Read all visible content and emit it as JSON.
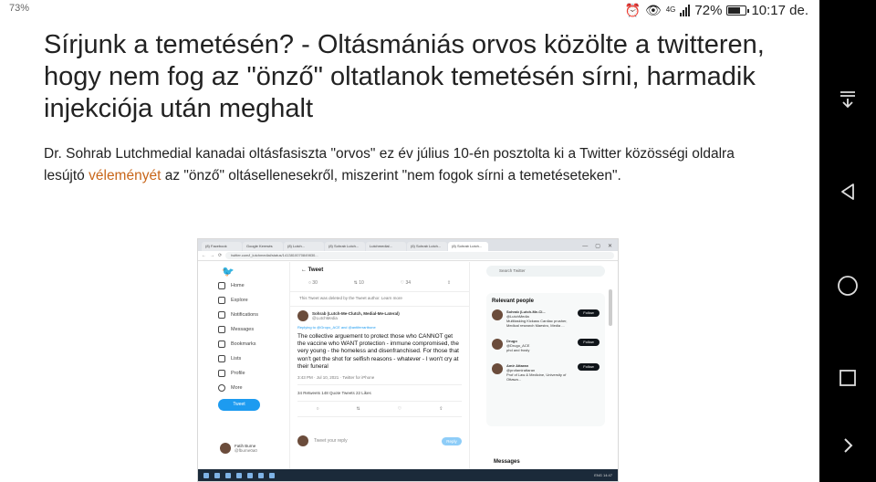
{
  "statusbar": {
    "zoom": "73%",
    "network": "4G",
    "battery": "72%",
    "battery_level": 0.72,
    "time": "10:17 de.",
    "icons": [
      "alarm-icon",
      "eye-icon",
      "signal-icon",
      "battery-icon"
    ]
  },
  "article": {
    "headline": "Sírjunk a temetésén? - Oltásmániás orvos közölte a twitteren, hogy nem fog az \"önző\" oltatlanok temetésén sírni, harmadik injekciója után meghalt",
    "lead_before": "Dr. Sohrab Lutchmedial kanadai oltásfasiszta \"orvos\" ez év július 10-én posztolta ki a Twitter közösségi oldalra lesújtó ",
    "lead_link": "véleményét",
    "lead_after": " az \"önző\" oltásellenesekről, miszerint \"nem fogok sírni a temetéseteken\".",
    "link_color": "#c8661a"
  },
  "embed": {
    "tabs": [
      "(8) Facebook",
      "Google Keresés",
      "(8) Lutch...",
      "(8) Sohrab Lutch...",
      "Lutchmedial...",
      "(6) Sohrab Lutch...",
      "(8) Sohrab Lutch..."
    ],
    "url": "twitter.com/i_lutchmedial/status/1413810070849830...",
    "nav_title_icon": "twitter-bird-icon",
    "nav": [
      "Home",
      "Explore",
      "Notifications",
      "Messages",
      "Bookmarks",
      "Lists",
      "Profile",
      "More"
    ],
    "tweet_button": "Tweet",
    "nav_user": "Fatih Burne",
    "nav_handle": "@fburne0a0",
    "main_title": "Tweet",
    "actions": [
      "○ 30",
      "⇅ 10",
      "♡ 34",
      "⇪"
    ],
    "deleted_note": "This Tweet was deleted by the Tweet author. Learn more",
    "author": "Sohrab (Lutch-Me-Clutch, Medial-Me-Lateral)",
    "author_handle": "@LutchMedia",
    "replying_to": "Replying to @Gropo_ACE and @antiferrartbone",
    "tweet_text": "The collective arguement to protect those who CANNOT get the vaccine who WANT protection - immune compromised, the very young - the homeless and disenfranchised. For those that won't get the shot for selfish reasons - whatever - I won't cry at their funeral",
    "tweet_meta": "3:43 PM · Jul 10, 2021 · Twitter for iPhone",
    "tweet_stats": "34 Retweets   148 Quote Tweets   22 Likes",
    "reply_placeholder": "Tweet your reply",
    "reply_button": "Reply",
    "search_placeholder": "Search Twitter",
    "relevant_title": "Relevant people",
    "people": [
      {
        "name": "Sohrab (Lutch-Me-Cl...",
        "handle": "@LutchMedia",
        "bio": "Multitasking Kickass Cardiac prusher, Medical research Maestro, Media ...",
        "follow": "Follow"
      },
      {
        "name": "Drugo",
        "handle": "@Drugo_ACE",
        "bio": "phd and frosty",
        "follow": "Follow"
      },
      {
        "name": "Amir Attaran",
        "handle": "@profamirattaran",
        "bio": "Prof of Law & Medicine, University of Ottawa...",
        "follow": "Follow"
      }
    ],
    "messages": "Messages",
    "taskbar_time": "ENG 14:47"
  }
}
